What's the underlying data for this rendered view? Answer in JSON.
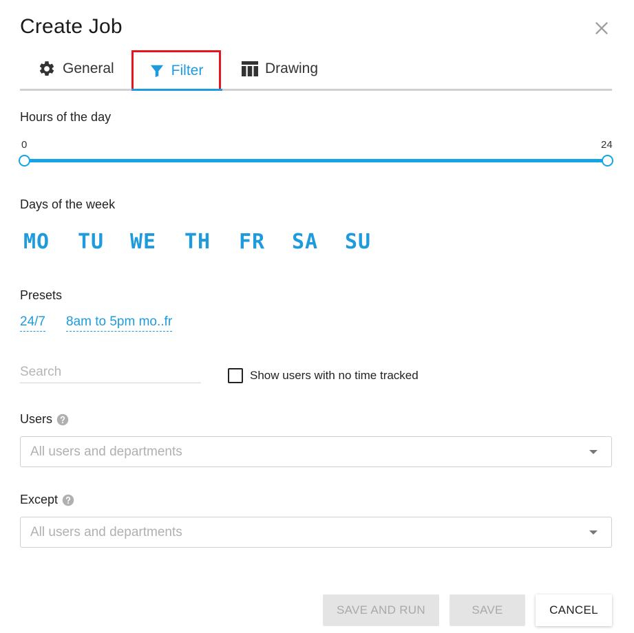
{
  "dialog": {
    "title": "Create Job"
  },
  "tabs": [
    {
      "label": "General",
      "icon": "gear-icon",
      "active": false
    },
    {
      "label": "Filter",
      "icon": "filter-icon",
      "active": true
    },
    {
      "label": "Drawing",
      "icon": "table-icon",
      "active": false
    }
  ],
  "hours": {
    "label": "Hours of the day",
    "min_label": "0",
    "max_label": "24",
    "range": [
      0,
      24
    ]
  },
  "days": {
    "label": "Days of the week",
    "items": [
      "MO",
      "TU",
      "WE",
      "TH",
      "FR",
      "SA",
      "SU"
    ]
  },
  "presets": {
    "label": "Presets",
    "items": [
      "24/7",
      "8am to 5pm mo..fr"
    ]
  },
  "search": {
    "placeholder": "Search",
    "value": ""
  },
  "show_no_time": {
    "label": "Show users with no time tracked",
    "checked": false
  },
  "users": {
    "label": "Users",
    "placeholder": "All users and departments"
  },
  "except": {
    "label": "Except",
    "placeholder": "All users and departments"
  },
  "actions": {
    "save_and_run": "SAVE AND RUN",
    "save": "SAVE",
    "cancel": "CANCEL"
  },
  "colors": {
    "accent": "#1e9bdc",
    "highlight_border": "#e8141c",
    "disabled_bg": "#e4e4e4"
  }
}
